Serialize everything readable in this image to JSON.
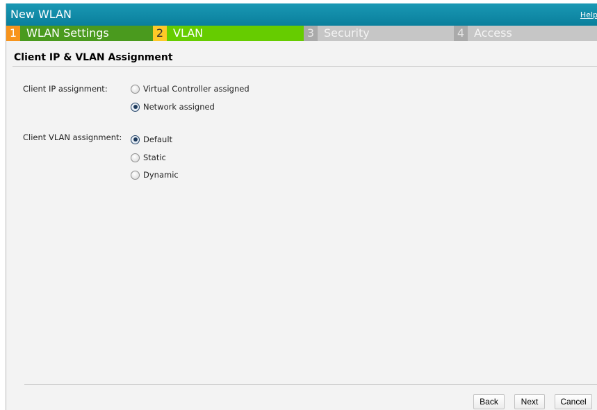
{
  "window": {
    "title": "New WLAN",
    "help_label": "Help"
  },
  "steps": [
    {
      "number": "1",
      "label": "WLAN Settings",
      "state": "completed"
    },
    {
      "number": "2",
      "label": "VLAN",
      "state": "active"
    },
    {
      "number": "3",
      "label": "Security",
      "state": "inactive"
    },
    {
      "number": "4",
      "label": "Access",
      "state": "inactive"
    }
  ],
  "section": {
    "title": "Client IP & VLAN Assignment"
  },
  "ip_assignment": {
    "label": "Client IP assignment:",
    "options": [
      {
        "label": "Virtual Controller assigned",
        "selected": false
      },
      {
        "label": "Network assigned",
        "selected": true
      }
    ]
  },
  "vlan_assignment": {
    "label": "Client VLAN assignment:",
    "options": [
      {
        "label": "Default",
        "selected": true
      },
      {
        "label": "Static",
        "selected": false
      },
      {
        "label": "Dynamic",
        "selected": false
      }
    ]
  },
  "buttons": {
    "back": "Back",
    "next": "Next",
    "cancel": "Cancel"
  },
  "colors": {
    "titlebar": "#0a7f9c",
    "step_completed": "#4a9a1e",
    "step_active": "#66cc00",
    "step_inactive": "#c6c6c6",
    "step1_number": "#f7941d",
    "step2_number": "#ffc928"
  }
}
